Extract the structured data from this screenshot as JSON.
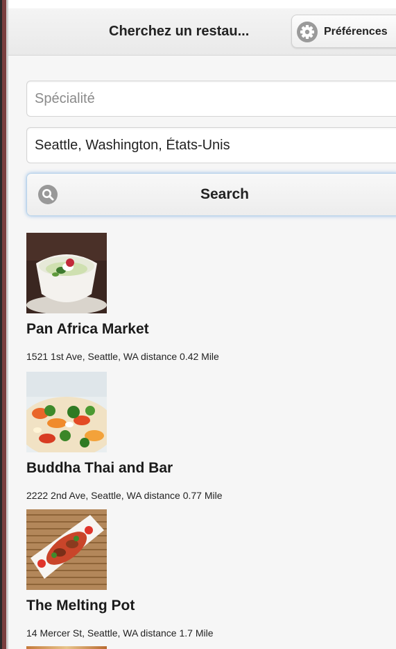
{
  "header": {
    "title": "Cherchez un restau...",
    "preferences_label": "Préférences",
    "preferences_icon": "gear-icon"
  },
  "form": {
    "specialty": {
      "value": "",
      "placeholder": "Spécialité"
    },
    "location": {
      "value": "Seattle, Washington, États-Unis",
      "placeholder": ""
    },
    "search_label": "Search",
    "search_icon": "search-icon"
  },
  "results": [
    {
      "name": "Pan Africa Market",
      "address": "1521 1st Ave, Seattle, WA distance 0.42 Mile",
      "image": "soup-dish-image"
    },
    {
      "name": "Buddha Thai and Bar",
      "address": "2222 2nd Ave, Seattle, WA distance 0.77 Mile",
      "image": "salad-dish-image"
    },
    {
      "name": "The Melting Pot",
      "address": "14 Mercer St, Seattle, WA distance 1.7 Mile",
      "image": "plated-dish-image"
    }
  ],
  "colors": {
    "search_glow": "#5096dc",
    "background": "#f6f6f6",
    "header": "#ececec"
  }
}
